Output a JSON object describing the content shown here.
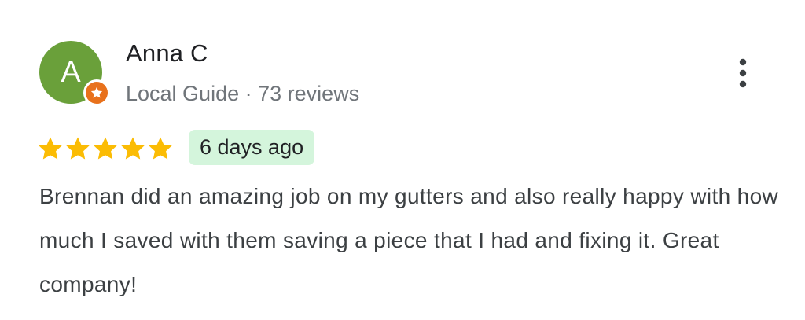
{
  "review": {
    "author": {
      "initial": "A",
      "name": "Anna C",
      "badge": "Local Guide",
      "separator": "·",
      "review_count": "73 reviews"
    },
    "rating": {
      "stars": 5,
      "max_stars": 5
    },
    "date_label": "6 days ago",
    "text": "Brennan did an amazing job on my gutters and also really happy with how much I saved with them saving a piece that I had and fixing it. Great company!"
  },
  "icons": {
    "avatar": "letter-avatar",
    "badge": "local-guide-star-icon",
    "star": "star-icon",
    "menu": "more-vertical-icon"
  },
  "colors": {
    "avatar_bg": "#6aa03a",
    "badge_bg": "#e8711c",
    "star": "#fbbc04",
    "date_pill_bg": "#d4f5dc",
    "name_text": "#202124",
    "meta_text": "#70757a",
    "body_text": "#3c4043",
    "menu_icon": "#3c4043"
  }
}
